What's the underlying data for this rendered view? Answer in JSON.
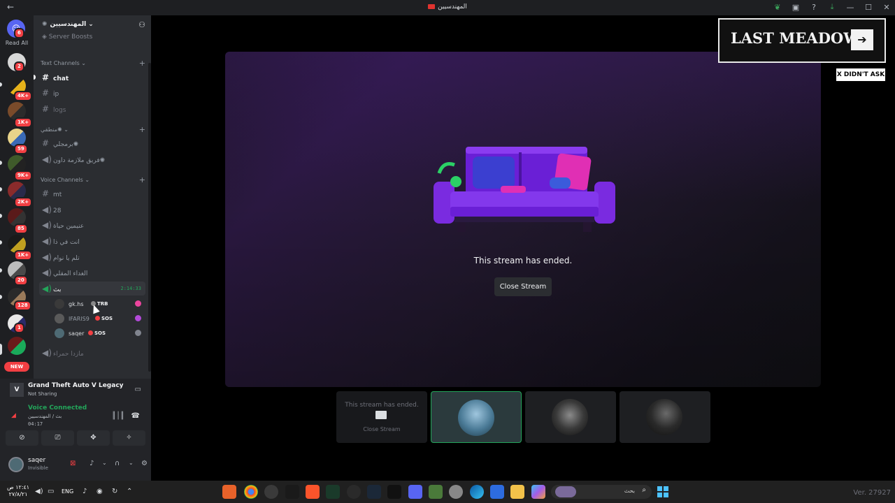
{
  "window": {
    "title": "المهندسيين",
    "back_glyph": "←",
    "controls": [
      "—",
      "☐",
      "✕"
    ]
  },
  "rail": {
    "dm_badge": "6",
    "read_all": "Read All",
    "badges": [
      "2",
      "4K+",
      "1K+",
      "59",
      "9K+",
      "2K+",
      "85",
      "1K+",
      "20",
      "128",
      "1"
    ],
    "new_label": "NEW"
  },
  "server": {
    "name": "المهندسيين",
    "boosts_label": "Server Boosts"
  },
  "categories": {
    "text": "Text Channels",
    "arabic": "منطقي",
    "voice": "Voice Channels"
  },
  "text_channels": [
    {
      "name": "chat"
    },
    {
      "name": "ip"
    },
    {
      "name": "logs"
    }
  ],
  "arabic_channels": [
    {
      "name": "برمجلي"
    },
    {
      "name": "فريق ملازمة داون"
    }
  ],
  "voice_channels": [
    {
      "name": "mt"
    },
    {
      "name": "28"
    },
    {
      "name": "عنيمين حياة"
    },
    {
      "name": "انت في ذا"
    },
    {
      "name": "تلم يا نوام"
    },
    {
      "name": "الغداء المقلي"
    }
  ],
  "active_voice": {
    "name": "بث",
    "timer": "2:14:33"
  },
  "voice_users": [
    {
      "name": "gk.hs",
      "tag": "TRB"
    },
    {
      "name": "IFARIS9",
      "tag": "SOS"
    },
    {
      "name": "saqer",
      "tag": "SOS"
    }
  ],
  "last_voice_channel": "مازدا حمراء",
  "activity": {
    "game": "Grand Theft Auto V Legacy",
    "status": "Not Sharing",
    "icon_text": "V"
  },
  "voice_connection": {
    "title": "Voice Connected",
    "channel": "بث / المهندسيين",
    "time": "04:17"
  },
  "user_panel": {
    "name": "saqer",
    "status": "Invisible"
  },
  "stage": {
    "ended_text": "This stream has ended.",
    "close_button": "Close Stream"
  },
  "tiles": {
    "self_ended": "This stream has ended.",
    "self_close": "Close Stream"
  },
  "ad": {
    "banner": "LAST MEADOW",
    "arrow": "➔",
    "tag": "X DIDN'T ASK"
  },
  "taskbar": {
    "time": "١٢:٤١ ص",
    "date": "٢٧/٨/٢١",
    "lang": "ENG",
    "search_placeholder": "بحث"
  },
  "version": "Ver. 27927",
  "colors": {
    "accent": "#5865f2",
    "voice_green": "#23a55a",
    "badge_red": "#f23f43",
    "background": "#000000"
  }
}
